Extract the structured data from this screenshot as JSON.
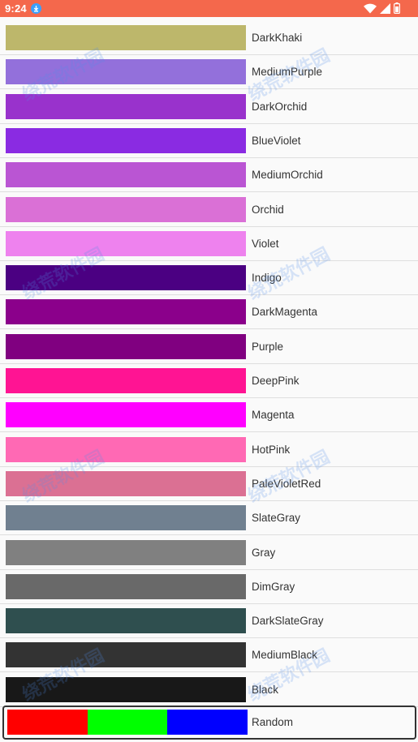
{
  "status_bar": {
    "time": "9:24",
    "icons": [
      "download-icon",
      "wifi-icon",
      "signal-icon",
      "battery-icon"
    ]
  },
  "colors": [
    {
      "name": "DarkKhaki",
      "hex": "#BDB76B"
    },
    {
      "name": "MediumPurple",
      "hex": "#9370DB"
    },
    {
      "name": "DarkOrchid",
      "hex": "#9932CC"
    },
    {
      "name": "BlueViolet",
      "hex": "#8A2BE2"
    },
    {
      "name": "MediumOrchid",
      "hex": "#BA55D3"
    },
    {
      "name": "Orchid",
      "hex": "#DA70D6"
    },
    {
      "name": "Violet",
      "hex": "#EE82EE"
    },
    {
      "name": "Indigo",
      "hex": "#4B0082"
    },
    {
      "name": "DarkMagenta",
      "hex": "#8B008B"
    },
    {
      "name": "Purple",
      "hex": "#800080"
    },
    {
      "name": "DeepPink",
      "hex": "#FF1493"
    },
    {
      "name": "Magenta",
      "hex": "#FF00FF"
    },
    {
      "name": "HotPink",
      "hex": "#FF69B4"
    },
    {
      "name": "PaleVioletRed",
      "hex": "#DB7093"
    },
    {
      "name": "SlateGray",
      "hex": "#708090"
    },
    {
      "name": "Gray",
      "hex": "#808080"
    },
    {
      "name": "DimGray",
      "hex": "#696969"
    },
    {
      "name": "DarkSlateGray",
      "hex": "#2F4F4F"
    },
    {
      "name": "MediumBlack",
      "hex": "#333333"
    },
    {
      "name": "Black",
      "hex": "#181818"
    }
  ],
  "random": {
    "name": "Random",
    "stripes": [
      "#FF0000",
      "#00FF00",
      "#0000FF"
    ]
  },
  "watermark": "绕荒软件园"
}
